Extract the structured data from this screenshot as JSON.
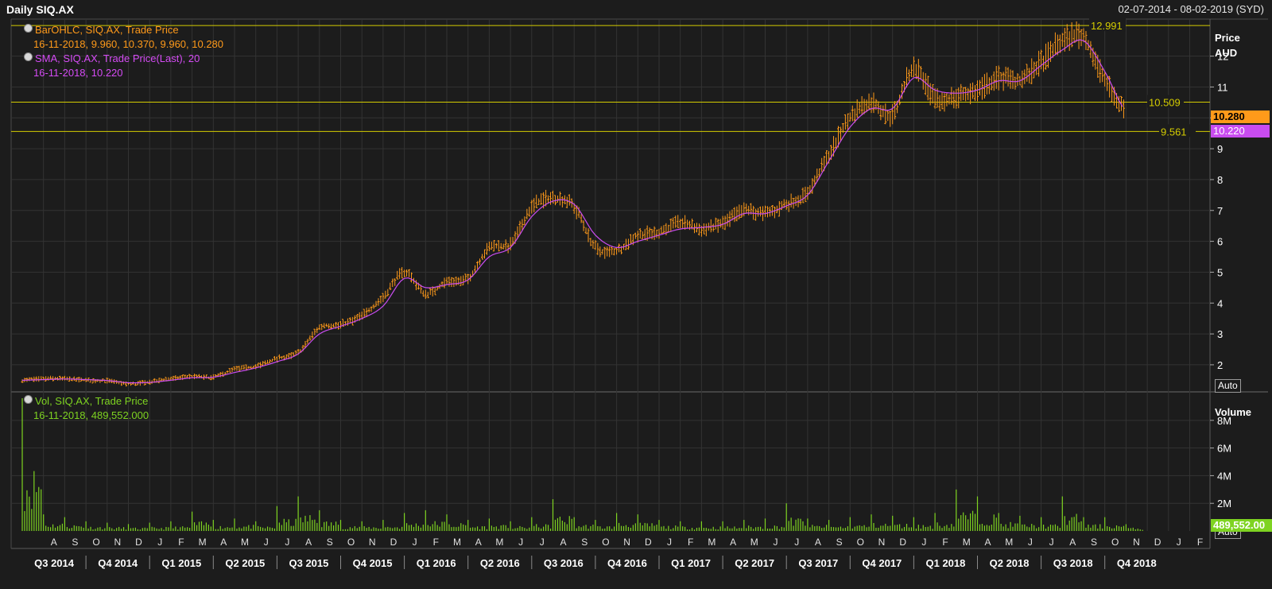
{
  "header": {
    "title": "Daily SIQ.AX",
    "date_range": "02-07-2014 - 08-02-2019 (SYD)"
  },
  "price_panel": {
    "legend": {
      "ohlc_name": "BarOHLC, SIQ.AX, Trade Price",
      "ohlc_values": "16-11-2018, 9.960, 10.370, 9.960, 10.280",
      "sma_name": "SMA, SIQ.AX, Trade Price(Last),  20",
      "sma_values": "16-11-2018, 10.220"
    },
    "axis_title_line1": "Price",
    "axis_title_line2": "AUD",
    "auto_label": "Auto",
    "last_price_tag": "10.280",
    "sma_tag": "10.220",
    "hline_labels": [
      "12.991",
      "10.509",
      "9.561"
    ]
  },
  "volume_panel": {
    "legend": {
      "vol_name": "Vol, SIQ.AX, Trade Price",
      "vol_values": "16-11-2018, 489,552.000"
    },
    "axis_title": "Volume",
    "auto_label": "Auto",
    "last_volume_tag": "489,552.00"
  },
  "colors": {
    "background": "#1c1c1c",
    "grid": "#333333",
    "bars": "#ff9a1a",
    "sma": "#c94cf0",
    "hlines": "#d4cc00",
    "volume": "#7ed321",
    "last_price_bg": "#ff9a1a",
    "sma_tag_bg": "#c94cf0"
  },
  "chart_data": [
    {
      "type": "line",
      "title": "",
      "ylabel": "Price AUD",
      "ylim": [
        1.2,
        13.2
      ],
      "yticks": [
        2,
        3,
        4,
        5,
        6,
        7,
        8,
        9,
        10,
        11,
        12
      ],
      "horizontal_lines": [
        12.991,
        10.509,
        9.561
      ],
      "x_month_labels": [
        "A",
        "S",
        "O",
        "N",
        "D",
        "J",
        "F",
        "M",
        "A",
        "M",
        "J",
        "J",
        "A",
        "S",
        "O",
        "N",
        "D",
        "J",
        "F",
        "M",
        "A",
        "M",
        "J",
        "J",
        "A",
        "S",
        "O",
        "N",
        "D",
        "J",
        "F",
        "M",
        "A",
        "M",
        "J",
        "J",
        "A",
        "S",
        "O",
        "N",
        "D",
        "J",
        "F",
        "M",
        "A",
        "M",
        "J",
        "J",
        "A",
        "S",
        "O",
        "N",
        "D",
        "J",
        "F"
      ],
      "x_quarter_labels": [
        "Q3 2014",
        "Q4 2014",
        "Q1 2015",
        "Q2 2015",
        "Q3 2015",
        "Q4 2015",
        "Q1 2016",
        "Q2 2016",
        "Q3 2016",
        "Q4 2016",
        "Q1 2017",
        "Q2 2017",
        "Q3 2017",
        "Q4 2017",
        "Q1 2018",
        "Q2 2018",
        "Q3 2018",
        "Q4 2018"
      ],
      "series": [
        {
          "name": "BarOHLC, SIQ.AX, Trade Price",
          "style": "ohlc",
          "x": [
            "2014-07",
            "2014-08",
            "2014-09",
            "2014-10",
            "2014-11",
            "2014-12",
            "2015-01",
            "2015-02",
            "2015-03",
            "2015-04",
            "2015-05",
            "2015-06",
            "2015-07",
            "2015-08",
            "2015-09",
            "2015-10",
            "2015-11",
            "2015-12",
            "2016-01",
            "2016-02",
            "2016-03",
            "2016-04",
            "2016-05",
            "2016-06",
            "2016-07",
            "2016-08",
            "2016-09",
            "2016-10",
            "2016-11",
            "2016-12",
            "2017-01",
            "2017-02",
            "2017-03",
            "2017-04",
            "2017-05",
            "2017-06",
            "2017-07",
            "2017-08",
            "2017-09",
            "2017-10",
            "2017-11",
            "2017-12",
            "2018-01",
            "2018-02",
            "2018-03",
            "2018-04",
            "2018-05",
            "2018-06",
            "2018-07",
            "2018-08",
            "2018-09",
            "2018-10",
            "2018-11"
          ],
          "values": [
            1.5,
            1.55,
            1.55,
            1.5,
            1.48,
            1.38,
            1.45,
            1.55,
            1.62,
            1.6,
            1.85,
            1.95,
            2.2,
            2.4,
            3.2,
            3.3,
            3.6,
            4.2,
            5.0,
            4.3,
            4.7,
            4.8,
            5.8,
            5.9,
            7.1,
            7.4,
            7.1,
            5.8,
            5.7,
            6.2,
            6.3,
            6.6,
            6.4,
            6.6,
            7.0,
            6.9,
            7.2,
            7.6,
            8.8,
            10.0,
            10.5,
            10.1,
            11.6,
            10.6,
            10.7,
            10.9,
            11.3,
            11.2,
            11.8,
            12.5,
            12.6,
            11.2,
            10.28
          ]
        },
        {
          "name": "SMA, SIQ.AX, Trade Price(Last),  20",
          "style": "line",
          "x": [
            "2014-07",
            "2014-08",
            "2014-09",
            "2014-10",
            "2014-11",
            "2014-12",
            "2015-01",
            "2015-02",
            "2015-03",
            "2015-04",
            "2015-05",
            "2015-06",
            "2015-07",
            "2015-08",
            "2015-09",
            "2015-10",
            "2015-11",
            "2015-12",
            "2016-01",
            "2016-02",
            "2016-03",
            "2016-04",
            "2016-05",
            "2016-06",
            "2016-07",
            "2016-08",
            "2016-09",
            "2016-10",
            "2016-11",
            "2016-12",
            "2017-01",
            "2017-02",
            "2017-03",
            "2017-04",
            "2017-05",
            "2017-06",
            "2017-07",
            "2017-08",
            "2017-09",
            "2017-10",
            "2017-11",
            "2017-12",
            "2018-01",
            "2018-02",
            "2018-03",
            "2018-04",
            "2018-05",
            "2018-06",
            "2018-07",
            "2018-08",
            "2018-09",
            "2018-10",
            "2018-11"
          ],
          "values": [
            1.5,
            1.52,
            1.54,
            1.52,
            1.49,
            1.42,
            1.43,
            1.5,
            1.58,
            1.6,
            1.75,
            1.9,
            2.1,
            2.35,
            3.0,
            3.25,
            3.5,
            3.9,
            4.8,
            4.5,
            4.6,
            4.75,
            5.5,
            5.8,
            6.8,
            7.3,
            7.2,
            6.2,
            5.8,
            6.0,
            6.2,
            6.4,
            6.45,
            6.55,
            6.9,
            6.9,
            7.15,
            7.5,
            8.6,
            9.7,
            10.3,
            10.3,
            11.3,
            10.9,
            10.8,
            10.9,
            11.2,
            11.2,
            11.7,
            12.2,
            12.5,
            11.5,
            10.22
          ]
        }
      ]
    },
    {
      "type": "bar",
      "title": "",
      "ylabel": "Volume",
      "ylim": [
        0,
        9600000
      ],
      "yticks": [
        2000000,
        4000000,
        6000000,
        8000000
      ],
      "ytick_labels": [
        "2M",
        "4M",
        "6M",
        "8M"
      ],
      "series": [
        {
          "name": "Vol, SIQ.AX, Trade Price",
          "x": [
            "2014-07",
            "2014-08",
            "2014-09",
            "2014-10",
            "2014-11",
            "2014-12",
            "2015-01",
            "2015-02",
            "2015-03",
            "2015-04",
            "2015-05",
            "2015-06",
            "2015-07",
            "2015-08",
            "2015-09",
            "2015-10",
            "2015-11",
            "2015-12",
            "2016-01",
            "2016-02",
            "2016-03",
            "2016-04",
            "2016-05",
            "2016-06",
            "2016-07",
            "2016-08",
            "2016-09",
            "2016-10",
            "2016-11",
            "2016-12",
            "2017-01",
            "2017-02",
            "2017-03",
            "2017-04",
            "2017-05",
            "2017-06",
            "2017-07",
            "2017-08",
            "2017-09",
            "2017-10",
            "2017-11",
            "2017-12",
            "2018-01",
            "2018-02",
            "2018-03",
            "2018-04",
            "2018-05",
            "2018-06",
            "2018-07",
            "2018-08",
            "2018-09",
            "2018-10",
            "2018-11"
          ],
          "values": [
            9600000,
            1200000,
            1000000,
            700000,
            600000,
            500000,
            600000,
            700000,
            1400000,
            800000,
            900000,
            700000,
            1800000,
            2500000,
            1500000,
            800000,
            700000,
            800000,
            1300000,
            1500000,
            1200000,
            800000,
            900000,
            700000,
            1000000,
            2300000,
            1000000,
            800000,
            1300000,
            1200000,
            800000,
            700000,
            700000,
            700000,
            800000,
            900000,
            2000000,
            900000,
            800000,
            1000000,
            1200000,
            1100000,
            1000000,
            1300000,
            3000000,
            2500000,
            1300000,
            1100000,
            1000000,
            2500000,
            1000000,
            1000000,
            489552
          ]
        }
      ]
    }
  ]
}
